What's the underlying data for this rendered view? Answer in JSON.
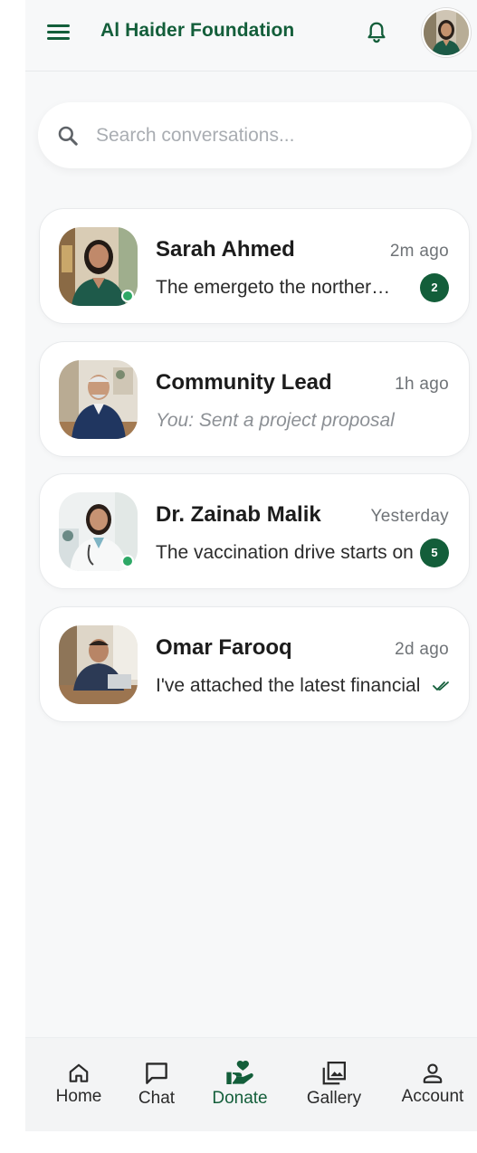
{
  "header": {
    "title": "Al Haider Foundation",
    "menu_icon": "menu-icon",
    "notification_icon": "bell-icon"
  },
  "search": {
    "placeholder": "Search conversations..."
  },
  "colors": {
    "brand_green": "#135e3a",
    "online_green": "#2ea866",
    "background": "#f7f8f9"
  },
  "conversations": [
    {
      "name": "Sarah Ahmed",
      "time": "2m ago",
      "preview": "The emergeto the northern district...",
      "unread": "2",
      "online": true
    },
    {
      "name": "Community Lead",
      "time": "1h ago",
      "preview": "You: Sent a project proposal",
      "online": false
    },
    {
      "name": "Dr. Zainab Malik",
      "time": "Yesterday",
      "preview": "The vaccination drive starts on",
      "unread": "5",
      "online": true
    },
    {
      "name": "Omar Farooq",
      "time": "2d ago",
      "preview": "I've attached the latest financial",
      "read": true,
      "online": false
    }
  ],
  "nav": {
    "items": [
      {
        "label": "Home",
        "icon": "home-icon"
      },
      {
        "label": "Chat",
        "icon": "chat-icon"
      },
      {
        "label": "Donate",
        "icon": "donate-hand-heart-icon",
        "active": true
      },
      {
        "label": "Gallery",
        "icon": "gallery-icon"
      },
      {
        "label": "Account",
        "icon": "account-icon"
      }
    ]
  }
}
